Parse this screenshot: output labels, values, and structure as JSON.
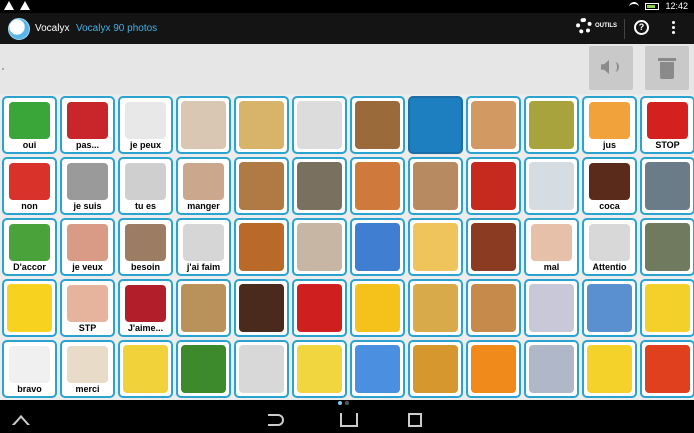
{
  "status": {
    "time": "12:42"
  },
  "app": {
    "name": "Vocalyx",
    "subtitle": "Vocalyx 90 photos",
    "tools_label": "OUTILS",
    "help_label": "?"
  },
  "sentence": {
    "text": ""
  },
  "cells": [
    {
      "label": "oui",
      "color": "#3aa63a",
      "icon": "check-icon"
    },
    {
      "label": "pas...",
      "color": "#c8262b",
      "icon": "thumbs-down-icon"
    },
    {
      "label": "je peux",
      "color": "#e8e8e8",
      "icon": "strongman-icon"
    },
    {
      "label": "",
      "color": "#d9c7b4",
      "icon": "drinking-icon"
    },
    {
      "label": "",
      "color": "#d8b46a",
      "icon": "cheese-icon"
    },
    {
      "label": "",
      "color": "#dcdcdc",
      "icon": "cutlery-icon"
    },
    {
      "label": "",
      "color": "#9a6a3a",
      "icon": "burger-icon"
    },
    {
      "label": "",
      "color": "#1e7fc0",
      "icon": "medical-icon"
    },
    {
      "label": "",
      "color": "#d29a62",
      "icon": "egg-icon"
    },
    {
      "label": "",
      "color": "#a8a33c",
      "icon": "pear-icon"
    },
    {
      "label": "jus",
      "color": "#f2a23a",
      "icon": "juice-icon"
    },
    {
      "label": "STOP",
      "color": "#d4211f",
      "icon": "stop-icon"
    },
    {
      "label": "non",
      "color": "#d8322b",
      "icon": "cross-icon"
    },
    {
      "label": "je suis",
      "color": "#9a9a9a",
      "icon": "fingerprint-icon"
    },
    {
      "label": "tu es",
      "color": "#cfcfcf",
      "icon": "hands-icon"
    },
    {
      "label": "manger",
      "color": "#caa78d",
      "icon": "eating-icon"
    },
    {
      "label": "",
      "color": "#b07a44",
      "icon": "bread-icon"
    },
    {
      "label": "",
      "color": "#7a7060",
      "icon": "statue-icon"
    },
    {
      "label": "",
      "color": "#cf7a3c",
      "icon": "pizza-icon"
    },
    {
      "label": "",
      "color": "#b88a62",
      "icon": "bedroom-icon"
    },
    {
      "label": "",
      "color": "#c62a1e",
      "icon": "tomato-icon"
    },
    {
      "label": "",
      "color": "#d6dde2",
      "icon": "glass-icon"
    },
    {
      "label": "coca",
      "color": "#5a2a1a",
      "icon": "cola-icon"
    },
    {
      "label": "",
      "color": "#6b7c88",
      "icon": "man-portrait-icon"
    },
    {
      "label": "D'accor",
      "color": "#4aa33a",
      "icon": "thumbs-up-icon"
    },
    {
      "label": "je veux",
      "color": "#d99b86",
      "icon": "hand-icon"
    },
    {
      "label": "besoin",
      "color": "#9c7d64",
      "icon": "person-icon"
    },
    {
      "label": "j'ai faim",
      "color": "#d6d6d6",
      "icon": "hungry-icon"
    },
    {
      "label": "",
      "color": "#b96a28",
      "icon": "roast-chicken-icon"
    },
    {
      "label": "",
      "color": "#c8b6a4",
      "icon": "couple-icon"
    },
    {
      "label": "",
      "color": "#3f7ed0",
      "icon": "rain-cloud-icon"
    },
    {
      "label": "",
      "color": "#efc45a",
      "icon": "fries-icon"
    },
    {
      "label": "",
      "color": "#8a3b22",
      "icon": "steak-icon"
    },
    {
      "label": "mal",
      "color": "#e6c0a8",
      "icon": "belly-icon"
    },
    {
      "label": "Attentio",
      "color": "#d8d8d8",
      "icon": "warning-icon"
    },
    {
      "label": "",
      "color": "#6f7a5e",
      "icon": "woman-portrait-icon"
    },
    {
      "label": "",
      "color": "#f7d320",
      "icon": "laughing-smiley-icon"
    },
    {
      "label": "STP",
      "color": "#e6b49c",
      "icon": "open-hand-icon"
    },
    {
      "label": "J'aime...",
      "color": "#b21f2a",
      "icon": "lips-icon"
    },
    {
      "label": "",
      "color": "#b8925a",
      "icon": "potatoes-icon"
    },
    {
      "label": "",
      "color": "#4a2a1c",
      "icon": "chocolate-icon"
    },
    {
      "label": "",
      "color": "#cf1f1f",
      "icon": "apple-icon"
    },
    {
      "label": "",
      "color": "#f5c21c",
      "icon": "sun-icon"
    },
    {
      "label": "",
      "color": "#d8aa4a",
      "icon": "chips-icon"
    },
    {
      "label": "",
      "color": "#c68a4a",
      "icon": "sandwich-icon"
    },
    {
      "label": "",
      "color": "#c8c8d8",
      "icon": "wheelchair-icon"
    },
    {
      "label": "",
      "color": "#5a8fd0",
      "icon": "trash-bin-icon"
    },
    {
      "label": "",
      "color": "#f4d02a",
      "icon": "sad-smiley-icon"
    },
    {
      "label": "bravo",
      "color": "#f0f0f0",
      "icon": "stickman-icon"
    },
    {
      "label": "merci",
      "color": "#e8dcc8",
      "icon": "thanks-icon"
    },
    {
      "label": "",
      "color": "#f2d23a",
      "icon": "silent-smiley-icon"
    },
    {
      "label": "",
      "color": "#3c8a2c",
      "icon": "lettuce-icon"
    },
    {
      "label": "",
      "color": "#d8d8d8",
      "icon": "shopping-cart-icon"
    },
    {
      "label": "",
      "color": "#f2d640",
      "icon": "banana-icon"
    },
    {
      "label": "",
      "color": "#4a8fe0",
      "icon": "sky-icon"
    },
    {
      "label": "",
      "color": "#d6982e",
      "icon": "croissant-icon"
    },
    {
      "label": "",
      "color": "#f08a1a",
      "icon": "oranges-icon"
    },
    {
      "label": "",
      "color": "#b0b8c8",
      "icon": "shopper-icon"
    },
    {
      "label": "",
      "color": "#f5d22a",
      "icon": "angel-smiley-icon"
    },
    {
      "label": "",
      "color": "#e0401e",
      "icon": "devil-smiley-icon"
    }
  ]
}
